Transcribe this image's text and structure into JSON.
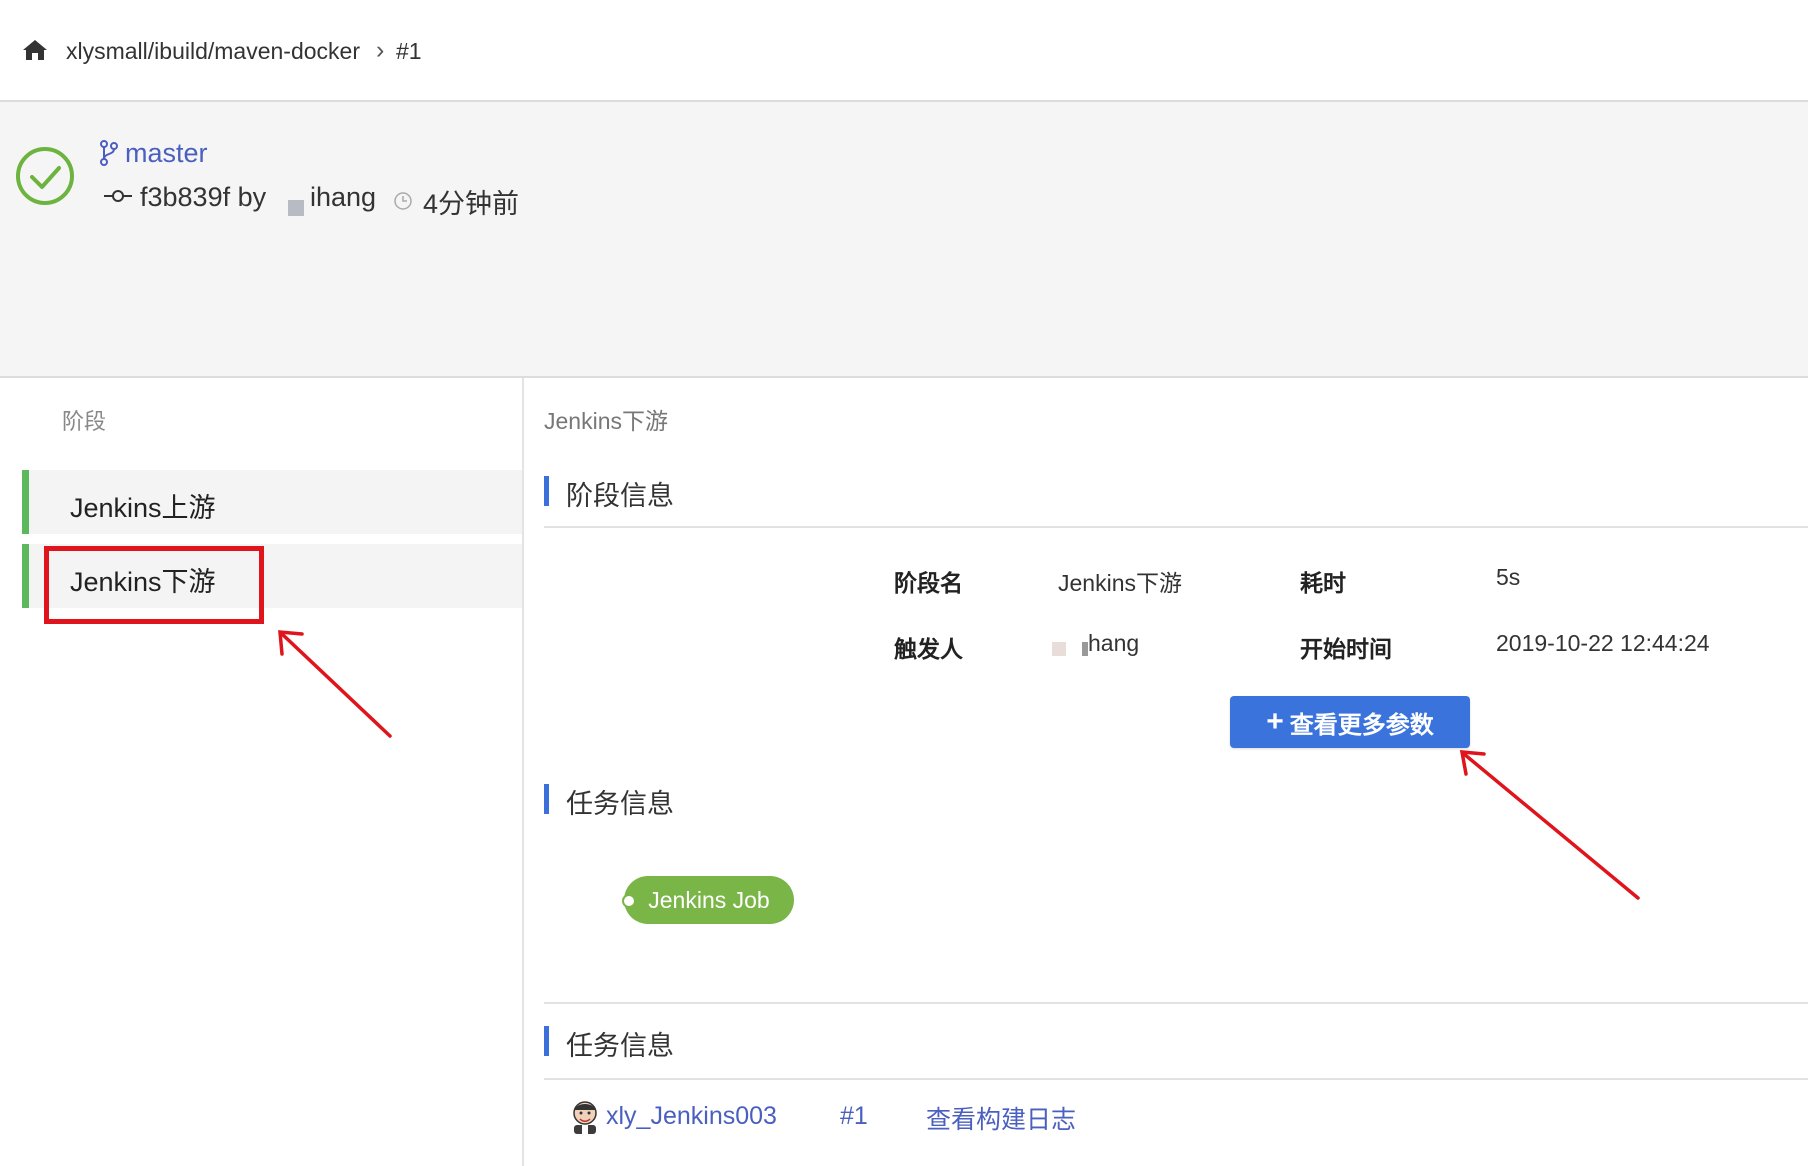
{
  "breadcrumb": {
    "path": "xlysmall/ibuild/maven-docker",
    "run": "#1"
  },
  "summary": {
    "branch": "master",
    "commit_prefix": "f3b839f by",
    "author": "ihang",
    "time_ago": "4分钟前",
    "status": "success",
    "status_color": "#6db33f"
  },
  "stages_panel": {
    "title": "阶段",
    "items": [
      {
        "label": "Jenkins上游",
        "status_color": "#5cb85c"
      },
      {
        "label": "Jenkins下游",
        "status_color": "#5cb85c"
      }
    ]
  },
  "detail": {
    "current_stage": "Jenkins下游",
    "stage_info_title": "阶段信息",
    "fields": {
      "stage_name_label": "阶段名",
      "stage_name_value": "Jenkins下游",
      "duration_label": "耗时",
      "duration_value": "5s",
      "trigger_label": "触发人",
      "trigger_value": "hang",
      "start_label": "开始时间",
      "start_value": "2019-10-22 12:44:24"
    },
    "more_params_button": "查看更多参数",
    "task_info_title": "任务信息",
    "job_pill": "Jenkins Job",
    "task_info_title_2": "任务信息",
    "job_link": "xly_Jenkins003",
    "build_number": "#1",
    "view_log": "查看构建日志"
  },
  "colors": {
    "accent": "#3b73dc",
    "success": "#5cb85c",
    "annotation": "#e0141c",
    "link": "#4a5fbf"
  }
}
